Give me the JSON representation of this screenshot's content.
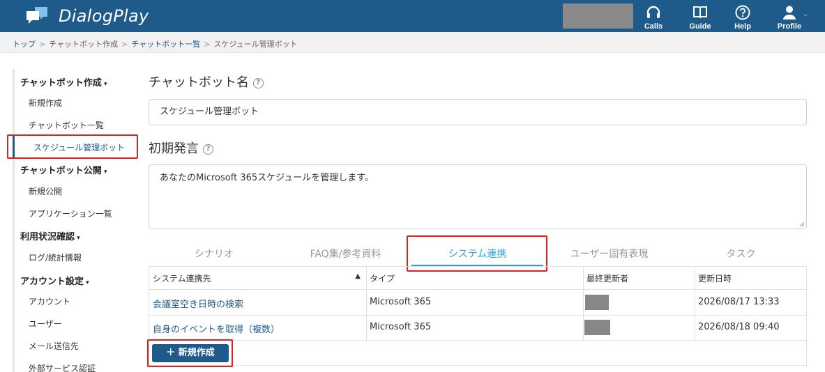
{
  "app": {
    "name": "DialogPlay"
  },
  "header": {
    "nav": [
      {
        "label": "Calls",
        "icon": "headset-icon"
      },
      {
        "label": "Guide",
        "icon": "book-icon"
      },
      {
        "label": "Help",
        "icon": "help-circle-icon"
      },
      {
        "label": "Profile",
        "icon": "user-icon"
      }
    ]
  },
  "breadcrumb": [
    "トップ",
    "チャットボット作成",
    "チャットボット一覧",
    "スケジュール管理ボット"
  ],
  "sidebar": {
    "sections": [
      {
        "title": "チャットボット作成",
        "items": [
          "新規作成",
          "チャットボット一覧",
          "スケジュール管理ボット"
        ]
      },
      {
        "title": "チャットボット公開",
        "items": [
          "新規公開",
          "アプリケーション一覧"
        ]
      },
      {
        "title": "利用状況確認",
        "items": [
          "ログ/統計情報"
        ]
      },
      {
        "title": "アカウント設定",
        "items": [
          "アカウント",
          "ユーザー",
          "メール送信先",
          "外部サービス認証"
        ]
      }
    ]
  },
  "form": {
    "name_label": "チャットボット名",
    "name_value": "スケジュール管理ボット",
    "greeting_label": "初期発言",
    "greeting_value": "あなたのMicrosoft 365スケジュールを管理します。"
  },
  "tabs": [
    "シナリオ",
    "FAQ集/参考資料",
    "システム連携",
    "ユーザー固有表現",
    "タスク"
  ],
  "active_tab": "システム連携",
  "table": {
    "headers": [
      "システム連携先",
      "タイプ",
      "最終更新者",
      "更新日時"
    ],
    "rows": [
      {
        "name": "会議室空き日時の検索",
        "type": "Microsoft 365",
        "updated": "2026/08/17 13:33"
      },
      {
        "name": "自身のイベントを取得（複数）",
        "type": "Microsoft 365",
        "updated": "2026/08/18 09:40"
      }
    ]
  },
  "new_button": "＋ 新規作成",
  "colors": {
    "header": "#1e5a8a",
    "accent": "#2aa2d8",
    "highlight": "#e02020"
  }
}
